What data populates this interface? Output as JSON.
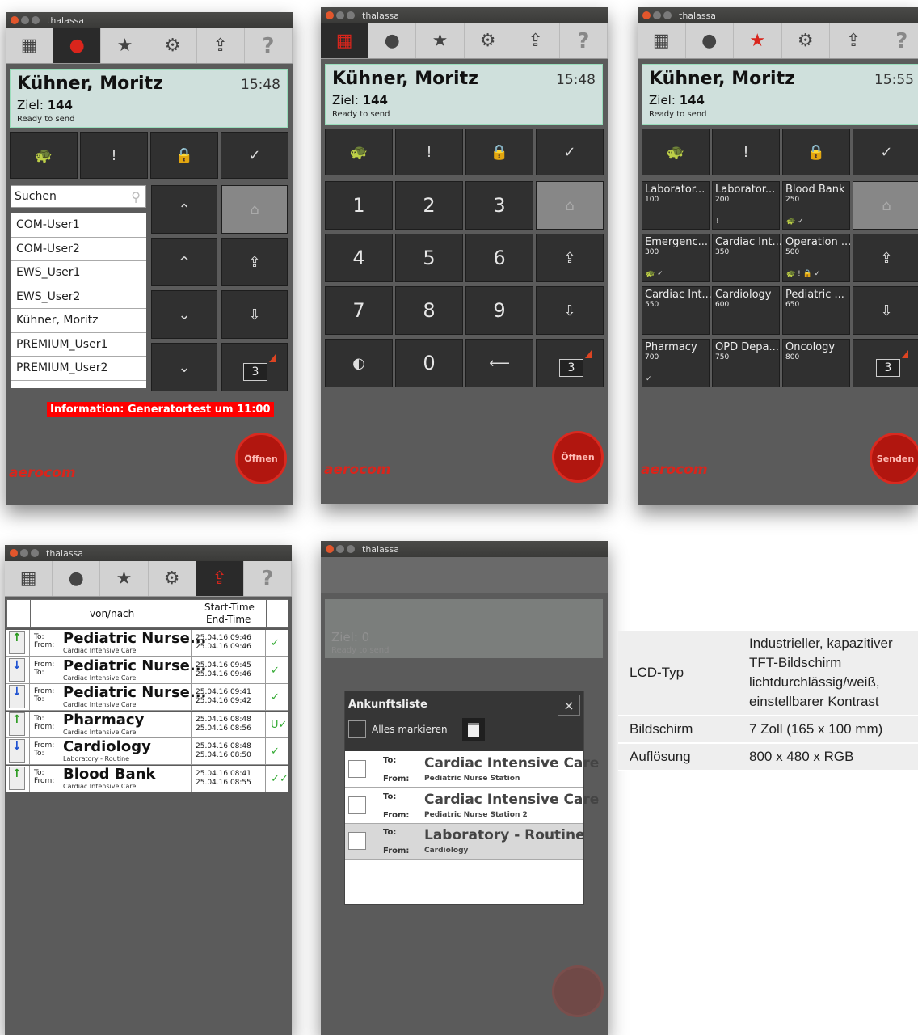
{
  "app_title": "thalassa",
  "contact": {
    "name": "Kühner, Moritz",
    "time_1": "15:48",
    "time_2": "15:48",
    "time_3": "15:55",
    "ziel_label": "Ziel:",
    "ziel_value": "144",
    "status": "Ready to send"
  },
  "search_placeholder": "Suchen",
  "users": [
    "COM-User1",
    "COM-User2",
    "EWS_User1",
    "EWS_User2",
    "Kühner, Moritz",
    "PREMIUM_User1",
    "PREMIUM_User2"
  ],
  "info_banner": "Information: Generatortest um 11:00",
  "badge_count": "3",
  "open_label": "Öffnen",
  "send_label": "Senden",
  "logo": "aerocom",
  "keypad": [
    "1",
    "2",
    "3",
    "4",
    "5",
    "6",
    "7",
    "8",
    "9",
    "0"
  ],
  "destinations": [
    {
      "name": "Laborator...",
      "code": "100",
      "icons": ""
    },
    {
      "name": "Laborator...",
      "code": "200",
      "icons": "!"
    },
    {
      "name": "Blood Bank",
      "code": "250",
      "icons": "🐢 ✓"
    },
    {
      "name": "Emergenc...",
      "code": "300",
      "icons": "🐢 ✓"
    },
    {
      "name": "Cardiac Int...",
      "code": "350",
      "icons": ""
    },
    {
      "name": "Operation ...",
      "code": "500",
      "icons": "🐢 ! 🔒 ✓"
    },
    {
      "name": "Cardiac Int...",
      "code": "550",
      "icons": ""
    },
    {
      "name": "Cardiology",
      "code": "600",
      "icons": ""
    },
    {
      "name": "Pediatric ...",
      "code": "650",
      "icons": ""
    },
    {
      "name": "Pharmacy",
      "code": "700",
      "icons": "✓"
    },
    {
      "name": "OPD Depa...",
      "code": "750",
      "icons": ""
    },
    {
      "name": "Oncology",
      "code": "800",
      "icons": ""
    }
  ],
  "history": {
    "col_vonnach": "von/nach",
    "col_start": "Start-Time",
    "col_end": "End-Time",
    "rows": [
      {
        "l1": "To:",
        "l2": "From:",
        "main": "Pediatric Nurse...",
        "sub": "Cardiac Intensive Care",
        "start": "25.04.16 09:46",
        "end": "25.04.16 09:46",
        "check": "✓",
        "dir": "up"
      },
      {
        "l1": "From:",
        "l2": "To:",
        "main": "Pediatric Nurse...",
        "sub": "Cardiac Intensive Care",
        "start": "25.04.16 09:45",
        "end": "25.04.16 09:46",
        "check": "✓",
        "dir": "down"
      },
      {
        "l1": "From:",
        "l2": "To:",
        "main": "Pediatric Nurse...",
        "sub": "Cardiac Intensive Care",
        "start": "25.04.16 09:41",
        "end": "25.04.16 09:42",
        "check": "✓",
        "dir": "down"
      },
      {
        "l1": "To:",
        "l2": "From:",
        "main": "Pharmacy",
        "sub": "Cardiac Intensive Care",
        "start": "25.04.16 08:48",
        "end": "25.04.16 08:56",
        "check": "U✓",
        "dir": "up"
      },
      {
        "l1": "From:",
        "l2": "To:",
        "main": "Cardiology",
        "sub": "Laboratory - Routine",
        "start": "25.04.16 08:48",
        "end": "25.04.16 08:50",
        "check": "✓",
        "dir": "down"
      },
      {
        "l1": "To:",
        "l2": "From:",
        "main": "Blood Bank",
        "sub": "Cardiac Intensive Care",
        "start": "25.04.16 08:41",
        "end": "25.04.16 08:55",
        "check": "✓✓",
        "dir": "up"
      }
    ]
  },
  "arrivals": {
    "title": "Ankunftsliste",
    "close": "×",
    "select_all": "Alles markieren",
    "bg_ziel": "Ziel: 0",
    "bg_status": "Ready to send",
    "to_label": "To:",
    "from_label": "From:",
    "rows": [
      {
        "to": "Cardiac Intensive Care",
        "from": "Pediatric Nurse Station"
      },
      {
        "to": "Cardiac Intensive Care",
        "from": "Pediatric Nurse Station 2"
      },
      {
        "to": "Laboratory - Routine",
        "from": "Cardiology"
      }
    ]
  },
  "specs": [
    {
      "key": "LCD-Typ",
      "value": "Industrieller, kapazitiver TFT-Bildschirm lichtdurchlässig/weiß, einstellbarer Kontrast"
    },
    {
      "key": "Bildschirm",
      "value": "7 Zoll (165 x 100 mm)"
    },
    {
      "key": "Auflösung",
      "value": "800 x 480 x RGB"
    }
  ]
}
